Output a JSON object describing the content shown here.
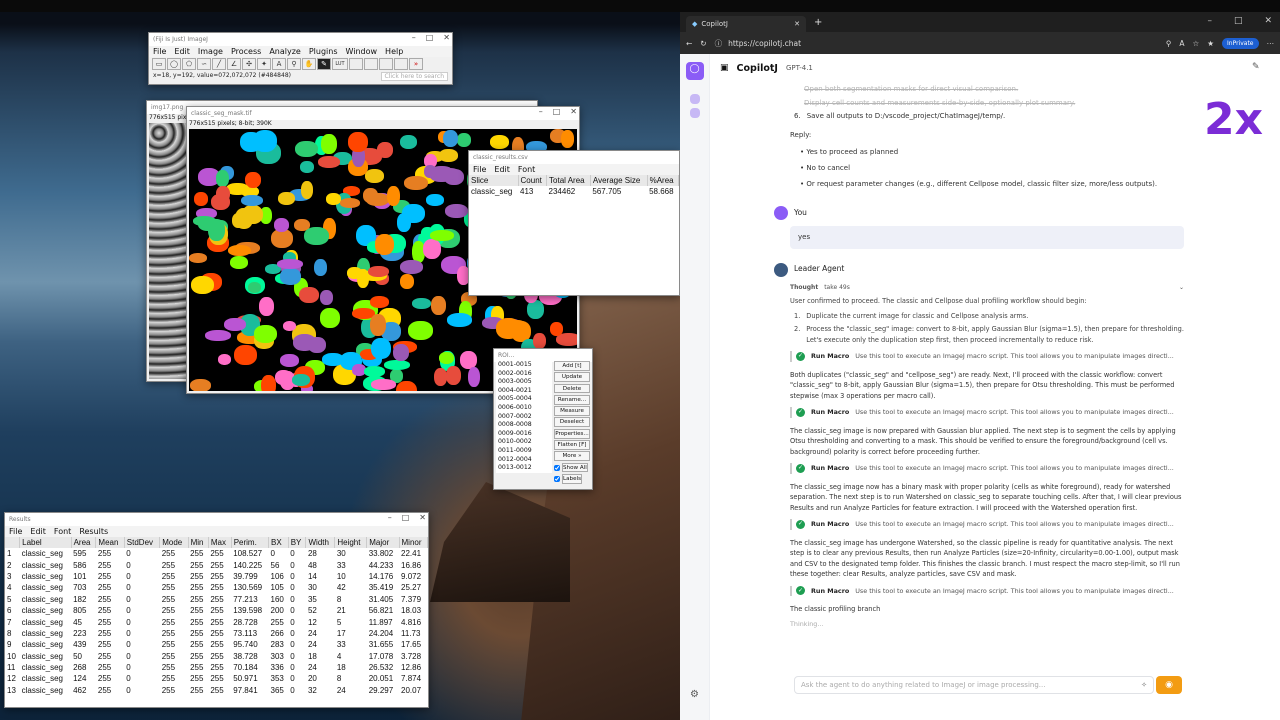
{
  "imagej": {
    "title": "(Fiji Is Just) ImageJ",
    "menu": [
      "File",
      "Edit",
      "Image",
      "Process",
      "Analyze",
      "Plugins",
      "Window",
      "Help"
    ],
    "lut": "LUT",
    "status": "x=18, y=192, value=072,072,072 (#484848)",
    "search_placeholder": "Click here to search"
  },
  "img17": {
    "title": "img17.png",
    "info": "776x515 pixels"
  },
  "mask": {
    "title": "classic_seg_mask.tif",
    "info": "776x515 pixels; 8-bit; 390K"
  },
  "csv": {
    "title": "classic_results.csv",
    "menu": [
      "File",
      "Edit",
      "Font"
    ],
    "headers": [
      "Slice",
      "Count",
      "Total Area",
      "Average Size",
      "%Area"
    ],
    "row": [
      "classic_seg",
      "413",
      "234462",
      "567.705",
      "58.668"
    ]
  },
  "roi": {
    "title": "ROI...",
    "items": [
      "0001-0015",
      "0002-0016",
      "0003-0005",
      "0004-0021",
      "0005-0004",
      "0006-0010",
      "0007-0002",
      "0008-0008",
      "0009-0016",
      "0010-0002",
      "0011-0009",
      "0012-0004",
      "0013-0012"
    ],
    "buttons": [
      "Add [t]",
      "Update",
      "Delete",
      "Rename...",
      "Measure",
      "Deselect",
      "Properties...",
      "Flatten [F]",
      "More »"
    ],
    "show_all": "Show All",
    "labels": "Labels"
  },
  "results": {
    "title": "Results",
    "menu": [
      "File",
      "Edit",
      "Font",
      "Results"
    ],
    "headers": [
      "",
      "Label",
      "Area",
      "Mean",
      "StdDev",
      "Mode",
      "Min",
      "Max",
      "Perim.",
      "BX",
      "BY",
      "Width",
      "Height",
      "Major",
      "Minor"
    ],
    "rows": [
      [
        "1",
        "classic_seg",
        "595",
        "255",
        "0",
        "255",
        "255",
        "255",
        "108.527",
        "0",
        "0",
        "28",
        "30",
        "33.802",
        "22.41"
      ],
      [
        "2",
        "classic_seg",
        "586",
        "255",
        "0",
        "255",
        "255",
        "255",
        "140.225",
        "56",
        "0",
        "48",
        "33",
        "44.233",
        "16.86"
      ],
      [
        "3",
        "classic_seg",
        "101",
        "255",
        "0",
        "255",
        "255",
        "255",
        "39.799",
        "106",
        "0",
        "14",
        "10",
        "14.176",
        "9.072"
      ],
      [
        "4",
        "classic_seg",
        "703",
        "255",
        "0",
        "255",
        "255",
        "255",
        "130.569",
        "105",
        "0",
        "30",
        "42",
        "35.419",
        "25.27"
      ],
      [
        "5",
        "classic_seg",
        "182",
        "255",
        "0",
        "255",
        "255",
        "255",
        "77.213",
        "160",
        "0",
        "35",
        "8",
        "31.405",
        "7.379"
      ],
      [
        "6",
        "classic_seg",
        "805",
        "255",
        "0",
        "255",
        "255",
        "255",
        "139.598",
        "200",
        "0",
        "52",
        "21",
        "56.821",
        "18.03"
      ],
      [
        "7",
        "classic_seg",
        "45",
        "255",
        "0",
        "255",
        "255",
        "255",
        "28.728",
        "255",
        "0",
        "12",
        "5",
        "11.897",
        "4.816"
      ],
      [
        "8",
        "classic_seg",
        "223",
        "255",
        "0",
        "255",
        "255",
        "255",
        "73.113",
        "266",
        "0",
        "24",
        "17",
        "24.204",
        "11.73"
      ],
      [
        "9",
        "classic_seg",
        "439",
        "255",
        "0",
        "255",
        "255",
        "255",
        "95.740",
        "283",
        "0",
        "24",
        "33",
        "31.655",
        "17.65"
      ],
      [
        "10",
        "classic_seg",
        "50",
        "255",
        "0",
        "255",
        "255",
        "255",
        "38.728",
        "303",
        "0",
        "18",
        "4",
        "17.078",
        "3.728"
      ],
      [
        "11",
        "classic_seg",
        "268",
        "255",
        "0",
        "255",
        "255",
        "255",
        "70.184",
        "336",
        "0",
        "24",
        "18",
        "26.532",
        "12.86"
      ],
      [
        "12",
        "classic_seg",
        "124",
        "255",
        "0",
        "255",
        "255",
        "255",
        "50.971",
        "353",
        "0",
        "20",
        "8",
        "20.051",
        "7.874"
      ],
      [
        "13",
        "classic_seg",
        "462",
        "255",
        "0",
        "255",
        "255",
        "255",
        "97.841",
        "365",
        "0",
        "32",
        "24",
        "29.297",
        "20.07"
      ]
    ]
  },
  "browser": {
    "tab_title": "CopilotJ",
    "url": "https://copilotj.chat",
    "private": "InPrivate"
  },
  "copilot": {
    "app_name": "CopilotJ",
    "model": "GPT-4.1",
    "speed": "2x",
    "faded": [
      "Open both segmentation masks for direct visual comparison.",
      "Display cell counts and measurements side-by-side, optionally plot summary."
    ],
    "step6_num": "6.",
    "step6": "Save all outputs to D:/vscode_project/ChatImageJ/temp/.",
    "reply_label": "Reply:",
    "options": [
      "Yes to proceed as planned",
      "No to cancel",
      "Or request parameter changes (e.g., different Cellpose model, classic filter size, more/less outputs)."
    ],
    "you_label": "You",
    "you_msg": "yes",
    "agent_label": "Leader Agent",
    "thought_label": "Thought",
    "thought_time": "take 49s",
    "thought": "User confirmed to proceed. The classic and Cellpose dual profiling workflow should begin:",
    "thought_steps": [
      [
        "1.",
        "Duplicate the current image for classic and Cellpose analysis arms."
      ],
      [
        "2.",
        "Process the \"classic_seg\" image: convert to 8-bit, apply Gaussian Blur (sigma=1.5), then prepare for thresholding. Let's execute only the duplication step first, then proceed incrementally to reduce risk."
      ]
    ],
    "macro_label": "Run Macro",
    "macro_desc": "Use this tool to execute an ImageJ macro script. This tool allows you to manipulate images directl...",
    "paras": [
      "Both duplicates (\"classic_seg\" and \"cellpose_seg\") are ready. Next, I'll proceed with the classic workflow: convert \"classic_seg\" to 8-bit, apply Gaussian Blur (sigma=1.5), then prepare for Otsu thresholding. This must be performed stepwise (max 3 operations per macro call).",
      "The classic_seg image is now prepared with Gaussian blur applied. The next step is to segment the cells by applying Otsu thresholding and converting to a mask. This should be verified to ensure the foreground/background (cell vs. background) polarity is correct before proceeding further.",
      "The classic_seg image now has a binary mask with proper polarity (cells as white foreground), ready for watershed separation. The next step is to run Watershed on classic_seg to separate touching cells. After that, I will clear previous Results and run Analyze Particles for feature extraction. I will proceed with the Watershed operation first.",
      "The classic_seg image has undergone Watershed, so the classic pipeline is ready for quantitative analysis. The next step is to clear any previous Results, then run Analyze Particles (size=20-Infinity, circularity=0.00-1.00), output mask and CSV to the designated temp folder. This finishes the classic branch. I must respect the macro step-limit, so I'll run these together: clear Results, analyze particles, save CSV and mask."
    ],
    "tail": "The classic profiling branch",
    "thinking": "Thinking...",
    "input_placeholder": "Ask the agent to do anything related to ImageJ or image processing..."
  }
}
